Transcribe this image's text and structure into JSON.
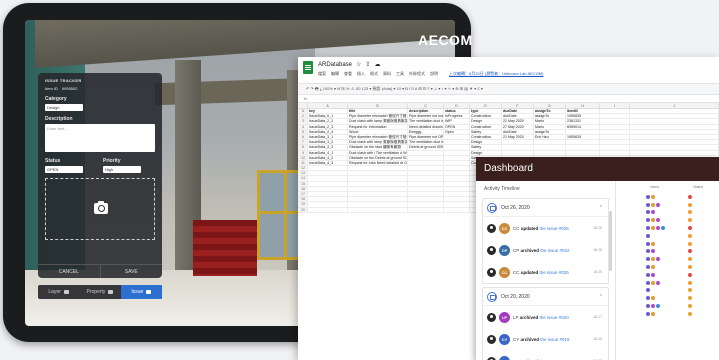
{
  "brand": "AECOM",
  "tracker": {
    "title": "ISSUE TRACKER",
    "item_id_label": "Item ID",
    "item_id_value": "9955502",
    "category_label": "Category",
    "category_value": "Design",
    "description_label": "Description",
    "description_placeholder": "Enter text...",
    "status_label": "Status",
    "status_value": "OPEN",
    "priority_label": "Priority",
    "priority_value": "High",
    "cancel": "CANCEL",
    "save": "SAVE"
  },
  "tabbar": {
    "layer": "Layer",
    "property": "Property",
    "issue": "Issue"
  },
  "sheet": {
    "title": "ARDatabase",
    "menus": [
      "檔案",
      "編輯",
      "查看",
      "插入",
      "格式",
      "資料",
      "工具",
      "外掛程式",
      "說明"
    ],
    "saved_note": "上次編輯：5月20日 (瀏覽者：Unknown Lab AECOM)",
    "toolbar": "↶ ↷ 🖶 ⤓   100% ▾   NT$  %  .0  .00  123 ▾   預設 (Arial) ▾   10 ▾   B  I  S  A   ⊞  ⊟   ≡ ▾  ⊥ ▾  ↕ ▾  ∿ ▾   ⊕  ⊞  ▤  ▼ ▾  Σ ▾",
    "col_letters": [
      "A",
      "B",
      "C",
      "D",
      "E",
      "F",
      "G",
      "H",
      "I",
      "J"
    ],
    "rows": [
      [
        "key",
        "title",
        "description",
        "status",
        "type",
        "dueDate",
        "assignTo",
        "itemID",
        "",
        ""
      ],
      [
        "IssueData_0_1",
        "Pipe diameter mismatch 管徑尺寸錯",
        "Pipe diameter not match",
        "InProgress",
        "Construction",
        "dueDate",
        "assignTo",
        "1955835",
        "",
        ""
      ],
      [
        "IssueData_2_2",
        "Duct clash with lamp 風管與燈具衝突",
        "The ventilation duct is",
        "WIP",
        "Design",
        "22 May 2020",
        "Mario",
        "2361331",
        "",
        ""
      ],
      [
        "IssueData_2_3",
        "Request for Information",
        "Need detailed drawing",
        "OPEN",
        "Construction",
        "27 May 2020",
        "Mario",
        "6959014",
        "",
        ""
      ],
      [
        "IssueData_2_4",
        "Wood",
        "Eeeggg",
        "Open",
        "Safety",
        "dueDate",
        "assignTo",
        "",
        "",
        ""
      ],
      [
        "IssueData_3_1",
        "Pipe diameter mismatch 管徑尺寸錯",
        "Pipe diameter not OPEN",
        "",
        "Construction",
        "21 May 2020",
        "Eric Hsu",
        "1955835",
        "",
        ""
      ],
      [
        "IssueData_3_2",
        "Duct clash with lamp 風管與燈具衝突",
        "The ventilation duct is WIP",
        "",
        "Design",
        "",
        "",
        "",
        "",
        ""
      ],
      [
        "IssueData_3_3",
        "Obstacle on the stair 樓梯有雜物",
        "Debris at ground ISSUED",
        "",
        "Safety",
        "",
        "",
        "",
        "",
        ""
      ],
      [
        "IssueData_4_1",
        "Duct clash with l The ventilation d WIP",
        "",
        "",
        "Design",
        "",
        "",
        "",
        "",
        ""
      ],
      [
        "IssueData_4_2",
        "Obstacle on the Debris at ground SOLVED",
        "",
        "",
        "Safety",
        "",
        "",
        "",
        "",
        ""
      ],
      [
        "IssueData_4_3",
        "Request for Infor Need detailed dr OPEN",
        "",
        "",
        "Construction",
        "",
        "",
        "",
        "",
        ""
      ],
      [
        "",
        "",
        "",
        "",
        "",
        "",
        "",
        "",
        "",
        ""
      ],
      [
        "",
        "",
        "",
        "",
        "",
        "",
        "",
        "",
        "",
        ""
      ],
      [
        "",
        "",
        "",
        "",
        "",
        "",
        "",
        "",
        "",
        ""
      ],
      [
        "",
        "",
        "",
        "",
        "",
        "",
        "",
        "",
        "",
        ""
      ],
      [
        "",
        "",
        "",
        "",
        "",
        "",
        "",
        "",
        "",
        ""
      ],
      [
        "",
        "",
        "",
        "",
        "",
        "",
        "",
        "",
        "",
        ""
      ],
      [
        "",
        "",
        "",
        "",
        "",
        "",
        "",
        "",
        "",
        ""
      ],
      [
        "",
        "",
        "",
        "",
        "",
        "",
        "",
        "",
        "",
        ""
      ],
      [
        "",
        "",
        "",
        "",
        "",
        "",
        "",
        "",
        "",
        ""
      ]
    ]
  },
  "dashboard": {
    "title": "Dashboard",
    "activity_title": "Activity Timeline",
    "groups": [
      {
        "date": "Oct 26, 2020",
        "items": [
          {
            "initials": "CC",
            "color": "#c9893a",
            "user": "CC",
            "verb": "updated",
            "ref": "the issue #025",
            "time": "18:25"
          },
          {
            "initials": "CP",
            "color": "#3b6ea5",
            "user": "CP",
            "verb": "archived",
            "ref": "the issue #022",
            "time": "18:25"
          },
          {
            "initials": "CC",
            "color": "#c9893a",
            "user": "CC",
            "verb": "updated",
            "ref": "the issue #025",
            "time": "18:25"
          }
        ]
      },
      {
        "date": "Oct 20, 2020",
        "items": [
          {
            "initials": "LP",
            "color": "#a03cc0",
            "user": "LP",
            "verb": "archived",
            "ref": "the issue #020",
            "time": "18:27"
          },
          {
            "initials": "CY",
            "color": "#3a66c8",
            "user": "CY",
            "verb": "archived",
            "ref": "the issue #015",
            "time": "18:25"
          },
          {
            "initials": "CY",
            "color": "#3a66c8",
            "user": "CY",
            "verb": "updated",
            "ref": "the issue #015",
            "time": "18:25"
          }
        ]
      }
    ],
    "right_head": [
      "Users",
      "Status"
    ]
  }
}
